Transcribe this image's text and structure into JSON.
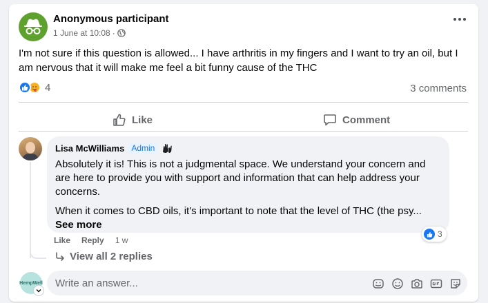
{
  "post": {
    "author": "Anonymous participant",
    "date": "1 June at 10:08",
    "separator": "·",
    "text": "I'm not sure if this question is allowed... I have arthritis in my fingers and I want to try an oil, but I am nervous that it will make me feel a bit funny cause of the THC",
    "reaction_count": "4",
    "comments_count": "3 comments",
    "avatar_color": "#5fa12e"
  },
  "actions": {
    "like_label": "Like",
    "comment_label": "Comment"
  },
  "comment": {
    "author": "Lisa McWilliams",
    "badge": "Admin",
    "paragraph1": "Absolutely it is! This is not a judgmental space. We understand your concern and are here to provide you with support and information that can help address your concerns.",
    "paragraph2": "When it comes to CBD oils, it's important to note that the level of THC (the psy...",
    "see_more": "See more",
    "like_label": "Like",
    "reply_label": "Reply",
    "time": "1 w",
    "reaction_count": "3",
    "view_replies": "View all 2 replies"
  },
  "composer": {
    "placeholder": "Write an answer...",
    "avatar_text": "HempWell"
  },
  "icons": {
    "post_avatar": "incognito-icon",
    "privacy": "globe-icon",
    "more": "more-dots-icon",
    "like": "thumbs-up-icon",
    "comment": "speech-bubble-icon",
    "badge_extra": "raised-hands-icon",
    "reply_arrow": "reply-arrow-icon",
    "tools": [
      "sticker-icon",
      "emoji-icon",
      "camera-icon",
      "gif-icon",
      "sticker-smile-icon"
    ]
  },
  "colors": {
    "accent": "#1877f2",
    "muted_text": "#65676b",
    "bubble_bg": "#f0f2f5"
  }
}
